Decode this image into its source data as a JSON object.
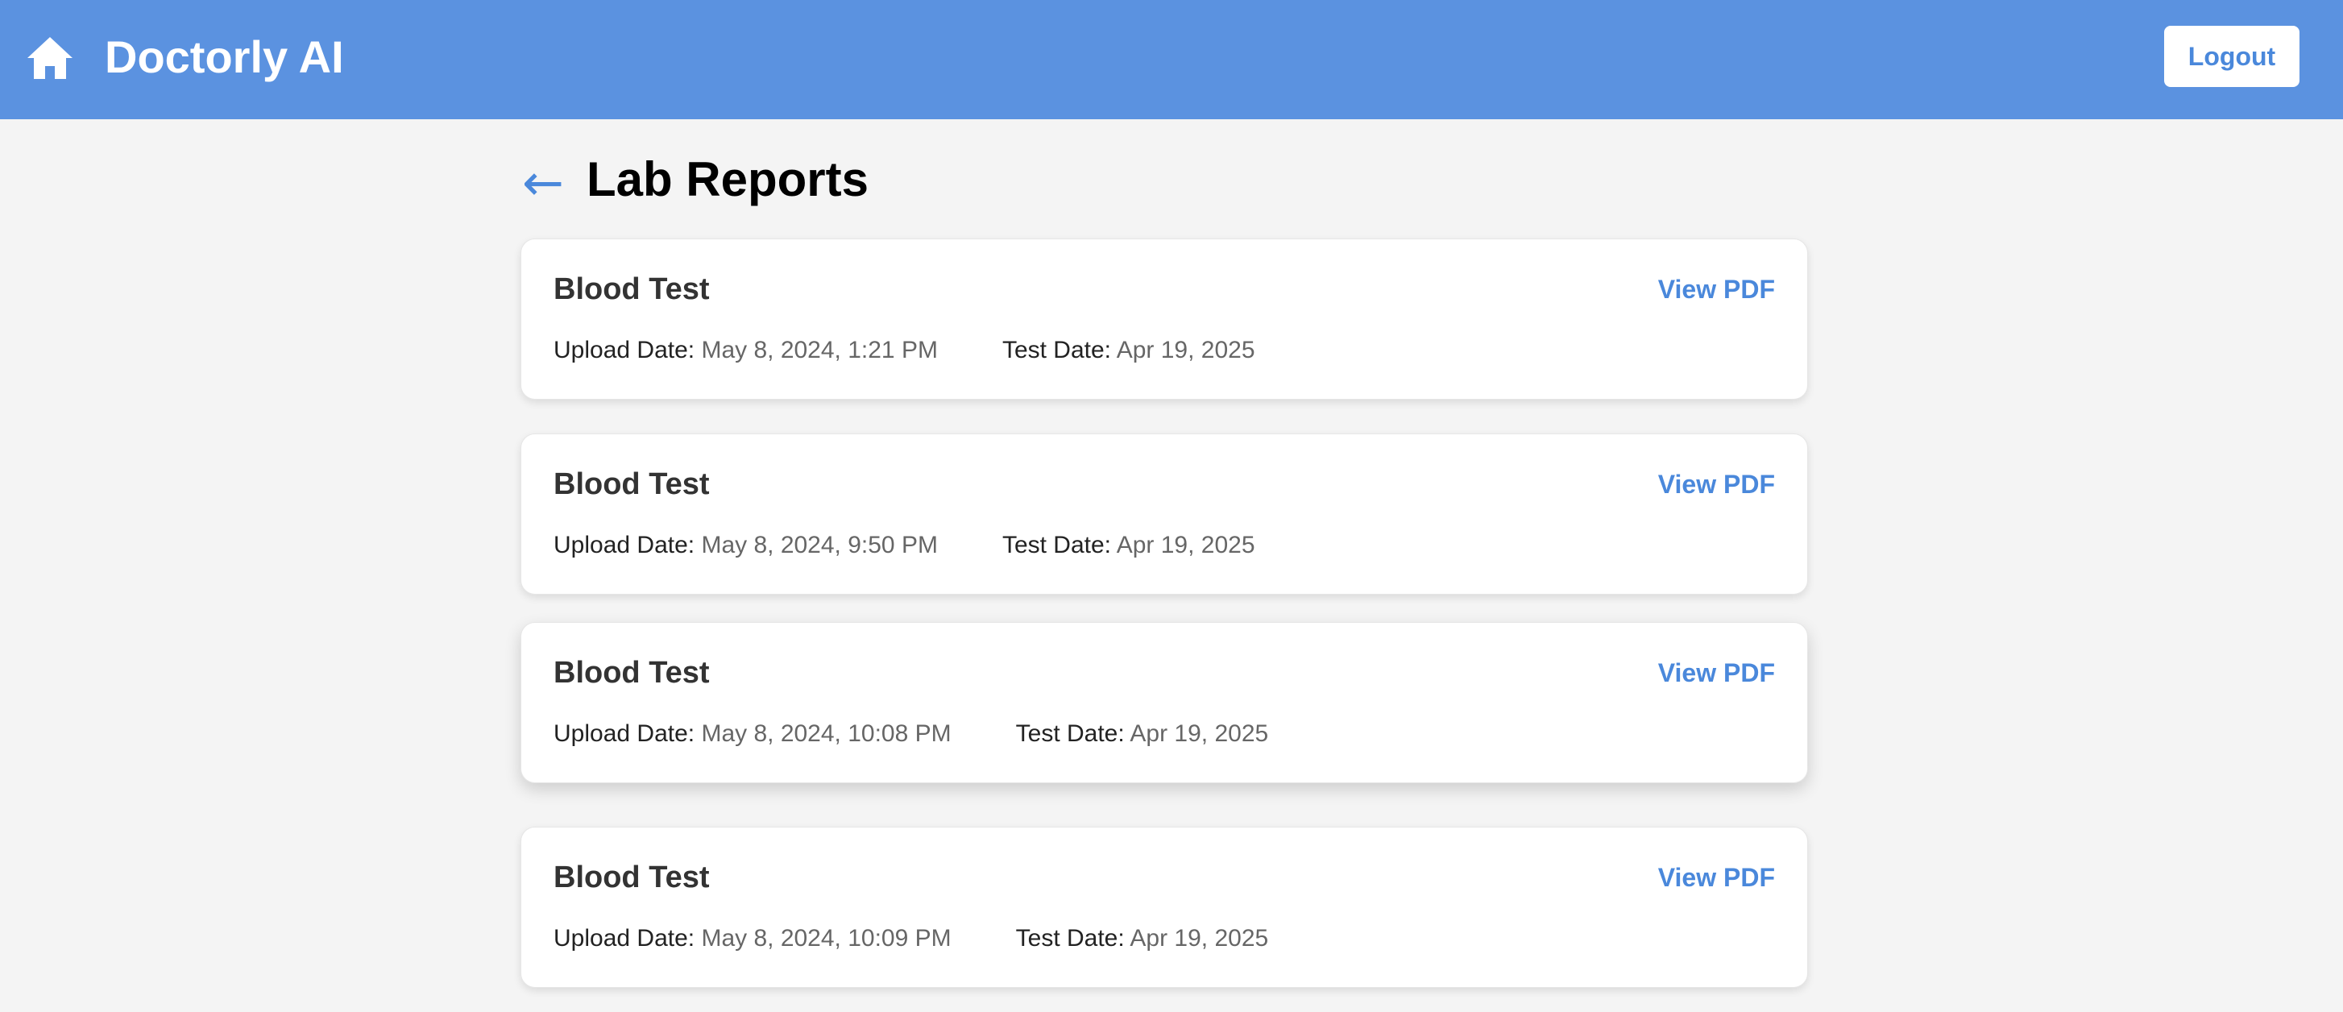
{
  "header": {
    "brand": "Doctorly AI",
    "logout_label": "Logout",
    "home_icon": "home-icon"
  },
  "page": {
    "back_glyph": "←",
    "title": "Lab Reports"
  },
  "reports": [
    {
      "title": "Blood Test",
      "view_label": "View PDF",
      "upload_label": "Upload Date:",
      "upload_date": "May 8, 2024, 1:21 PM",
      "test_label": "Test Date:",
      "test_date": "Apr 19, 2025"
    },
    {
      "title": "Blood Test",
      "view_label": "View PDF",
      "upload_label": "Upload Date:",
      "upload_date": "May 8, 2024, 9:50 PM",
      "test_label": "Test Date:",
      "test_date": "Apr 19, 2025"
    },
    {
      "title": "Blood Test",
      "view_label": "View PDF",
      "upload_label": "Upload Date:",
      "upload_date": "May 8, 2024, 10:08 PM",
      "test_label": "Test Date:",
      "test_date": "Apr 19, 2025"
    },
    {
      "title": "Blood Test",
      "view_label": "View PDF",
      "upload_label": "Upload Date:",
      "upload_date": "May 8, 2024, 10:09 PM",
      "test_label": "Test Date:",
      "test_date": "Apr 19, 2025"
    }
  ],
  "colors": {
    "header_bg": "#5b92e0",
    "accent": "#4a88db",
    "page_bg": "#f4f4f4"
  }
}
